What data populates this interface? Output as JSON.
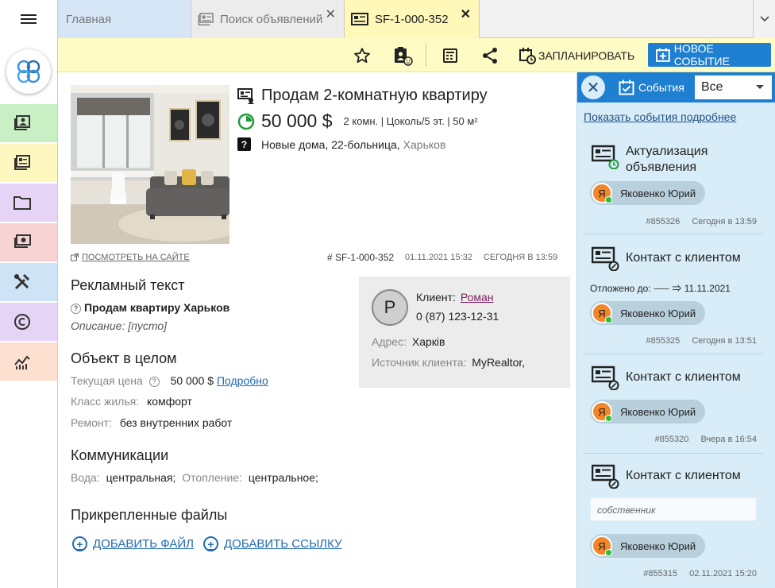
{
  "tabs": [
    {
      "label": "Главная"
    },
    {
      "label": "Поиск объявлений",
      "close": "✕"
    },
    {
      "label": "SF-1-000-352",
      "close": "✕"
    }
  ],
  "toolbar": {
    "schedule_label": "ЗАПЛАНИРОВАТЬ",
    "new_event_label": "НОВОЕ СОБЫТИЕ"
  },
  "listing": {
    "title": "Продам 2-комнатную квартиру",
    "price": "50 000 $",
    "params": "2 комн. | Цоколь/5 эт. | 50 м²",
    "address_main": "Новые дома, 22-больница,",
    "address_city": "Харьков",
    "view_on_site": "ПОСМОТРЕТЬ НА САЙТЕ",
    "code": "# SF-1-000-352",
    "created": "01.11.2021 15:32",
    "updated": "СЕГОДНЯ В 13:59"
  },
  "ad_text": {
    "section_title": "Рекламный текст",
    "headline": "Продам квартиру Харьков",
    "description": "Описание: [пусто]"
  },
  "object": {
    "section_title": "Объект в целом",
    "price_label": "Текущая цена",
    "price_value": "50 000 $",
    "price_more": "Подробно",
    "class_label": "Класс жилья:",
    "class_value": "комфорт",
    "repair_label": "Ремонт:",
    "repair_value": "без внутренних работ"
  },
  "communications": {
    "section_title": "Коммуникации",
    "water_label": "Вода:",
    "water_value": "центральная;",
    "heating_label": "Отопление:",
    "heating_value": "центральное;"
  },
  "files": {
    "section_title": "Прикрепленные файлы",
    "add_file": "ДОБАВИТЬ ФАЙЛ",
    "add_link": "ДОБАВИТЬ ССЫЛКУ"
  },
  "client": {
    "avatar_letter": "Р",
    "label": "Клиент:",
    "name": "Роман",
    "phone": "0 (87) 123-12-31",
    "address_label": "Адрес:",
    "address_value": "Харків",
    "source_label": "Источник клиента:",
    "source_value": "MyRealtor,"
  },
  "panel": {
    "title": "События",
    "filter": "Все",
    "show_more": "Показать события подробнее",
    "events": [
      {
        "title": "Актуализация объявления",
        "person": "Яковенко Юрий",
        "avatar": "Я",
        "id": "#855326",
        "time": "Сегодня в 13:59"
      },
      {
        "title": "Контакт с клиентом",
        "postponed": "Отложено до: ⸺ ⇒ 11.11.2021",
        "person": "Яковенко Юрий",
        "avatar": "Я",
        "id": "#855325",
        "time": "Сегодня в 13:51"
      },
      {
        "title": "Контакт с клиентом",
        "person": "Яковенко Юрий",
        "avatar": "Я",
        "id": "#855320",
        "time": "Вчера в 16:54"
      },
      {
        "title": "Контакт с клиентом",
        "comment": "собственник",
        "person": "Яковенко Юрий",
        "avatar": "Я",
        "id": "#855315",
        "time": "02.11.2021 15:20"
      }
    ]
  },
  "colors": {
    "accent": "#1f7fd1",
    "toolbar_bg": "#fffbc4",
    "panel_bg": "#d8edf7",
    "online_dot": "#2dbb3a",
    "avatar_orange": "#f2872a"
  }
}
